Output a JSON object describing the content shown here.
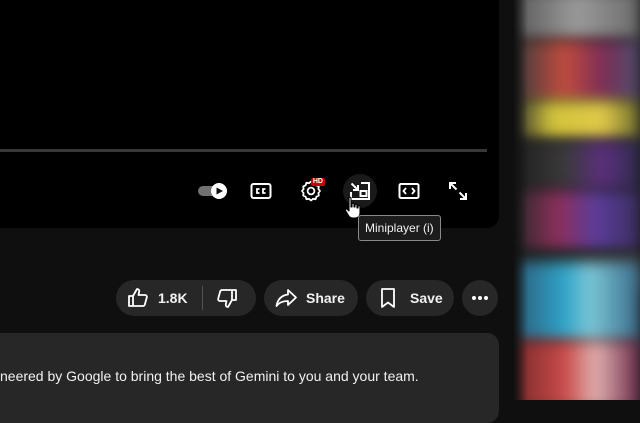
{
  "player": {
    "controls": {
      "autoplay_icon": "autoplay-toggle-icon",
      "subtitles_icon": "closed-captions-icon",
      "settings_icon": "gear-icon",
      "settings_badge": "HD",
      "miniplayer_icon": "miniplayer-icon",
      "theater_icon": "theater-mode-icon",
      "fullscreen_icon": "fullscreen-icon"
    },
    "tooltip": "Miniplayer (i)"
  },
  "actions": {
    "like_count": "1.8K",
    "like_icon": "thumbs-up-icon",
    "dislike_icon": "thumbs-down-icon",
    "share_label": "Share",
    "share_icon": "share-arrow-icon",
    "save_label": "Save",
    "save_icon": "bookmark-icon",
    "more_icon": "more-horizontal-icon"
  },
  "description": {
    "text": "neered by Google to bring the best of Gemini to you and your team."
  },
  "colors": {
    "page_background": "#0f0f0f",
    "pill_background": "#272727",
    "badge_red": "#cc0000"
  }
}
